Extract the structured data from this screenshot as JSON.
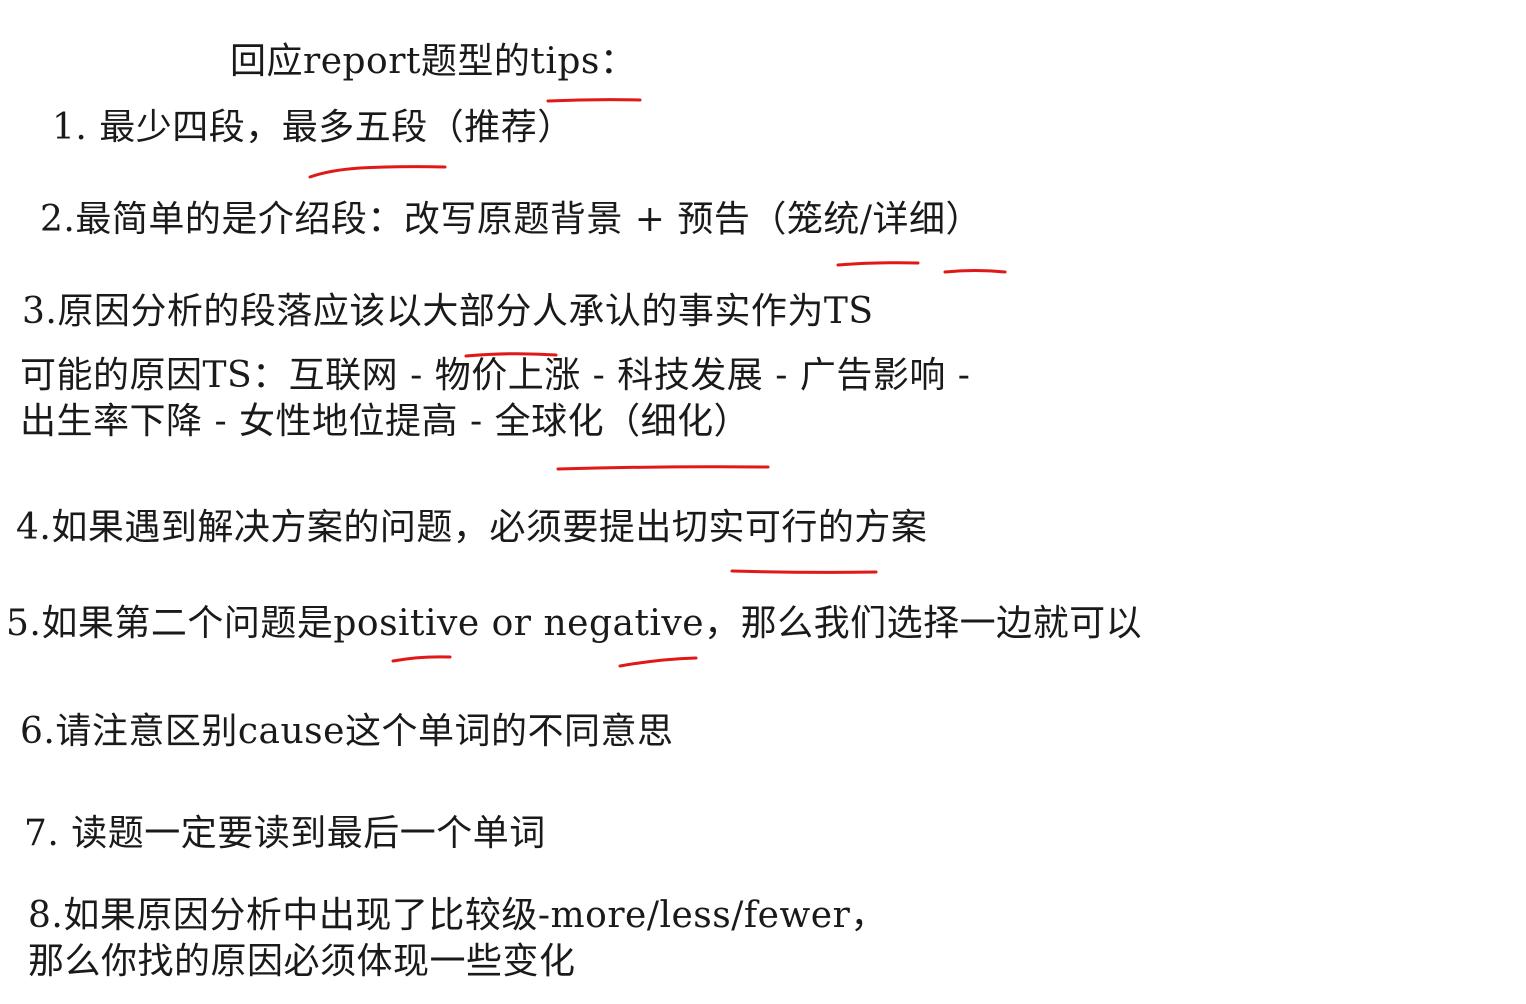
{
  "title": "回应report题型的tips：",
  "tips": [
    {
      "text": "1. 最少四段，最多五段（推荐）"
    },
    {
      "text": "2.最简单的是介绍段：改写原题背景 + 预告（笼统/详细）"
    },
    {
      "text": "3.原因分析的段落应该以大部分人承认的事实作为TS"
    },
    {
      "text": "可能的原因TS：互联网 - 物价上涨 - 科技发展 - 广告影响 -"
    },
    {
      "text": "出生率下降 - 女性地位提高 - 全球化（细化）"
    },
    {
      "text": "4.如果遇到解决方案的问题，必须要提出切实可行的方案"
    },
    {
      "text": "5.如果第二个问题是positive or negative，那么我们选择一边就可以"
    },
    {
      "text": "6.请注意区别cause这个单词的不同意思"
    },
    {
      "text": "7. 读题一定要读到最后一个单词"
    },
    {
      "text": "8.如果原因分析中出现了比较级-more/less/fewer，"
    },
    {
      "text": "那么你找的原因必须体现一些变化"
    }
  ],
  "annotation_color": "#e01818"
}
